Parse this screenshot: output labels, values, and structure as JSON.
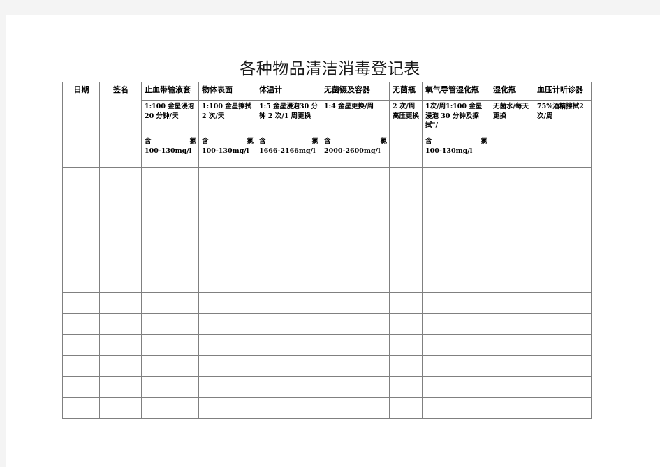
{
  "document": {
    "title": "各种物品清洁消毒登记表"
  },
  "table": {
    "row_label_date": "日期",
    "row_label_sign": "签名",
    "columns": [
      {
        "name": "止血带输液套",
        "method": "1:100  金星浸泡 20 分钟/天",
        "conc_label_a": "含",
        "conc_label_b": "氯",
        "conc_value": "100-130mg/l"
      },
      {
        "name": "物体表面",
        "method": "1:100 金星擦拭2 次/天",
        "conc_label_a": "含",
        "conc_label_b": "氯",
        "conc_value": "100-130mg/l"
      },
      {
        "name": "体温计",
        "method": "1:5 金星浸泡30 分钟 2 次/1 周更换",
        "conc_label_a": "含",
        "conc_label_b": "氯",
        "conc_value": "1666-2166mg/l"
      },
      {
        "name": "无菌镊及容器",
        "method": "1:4 金星更换/周",
        "conc_label_a": "含",
        "conc_label_b": "氯",
        "conc_value": "2000-2600mg/l"
      },
      {
        "name": "无菌瓶",
        "method": "2 次/周高压更换",
        "conc_label_a": "",
        "conc_label_b": "",
        "conc_value": ""
      },
      {
        "name": "氧气导管湿化瓶",
        "method": "1次/周1:100 金星浸泡 30 分钟及擦拭\"/",
        "conc_label_a": "含",
        "conc_label_b": "氯",
        "conc_value": "100-130mg/l"
      },
      {
        "name": "湿化瓶",
        "method": "无菌水/每天更换",
        "conc_label_a": "",
        "conc_label_b": "",
        "conc_value": ""
      },
      {
        "name": "血压计听诊器",
        "method": "75%酒精擦拭2 次/周",
        "conc_label_a": "",
        "conc_label_b": "",
        "conc_value": ""
      }
    ],
    "body_row_count": 12
  },
  "colors": {
    "page_background": "#ffffff",
    "canvas_background": "#f4f4f4",
    "grid_line": "#808080",
    "text": "#000000",
    "title_text": "#1a1a1a"
  }
}
